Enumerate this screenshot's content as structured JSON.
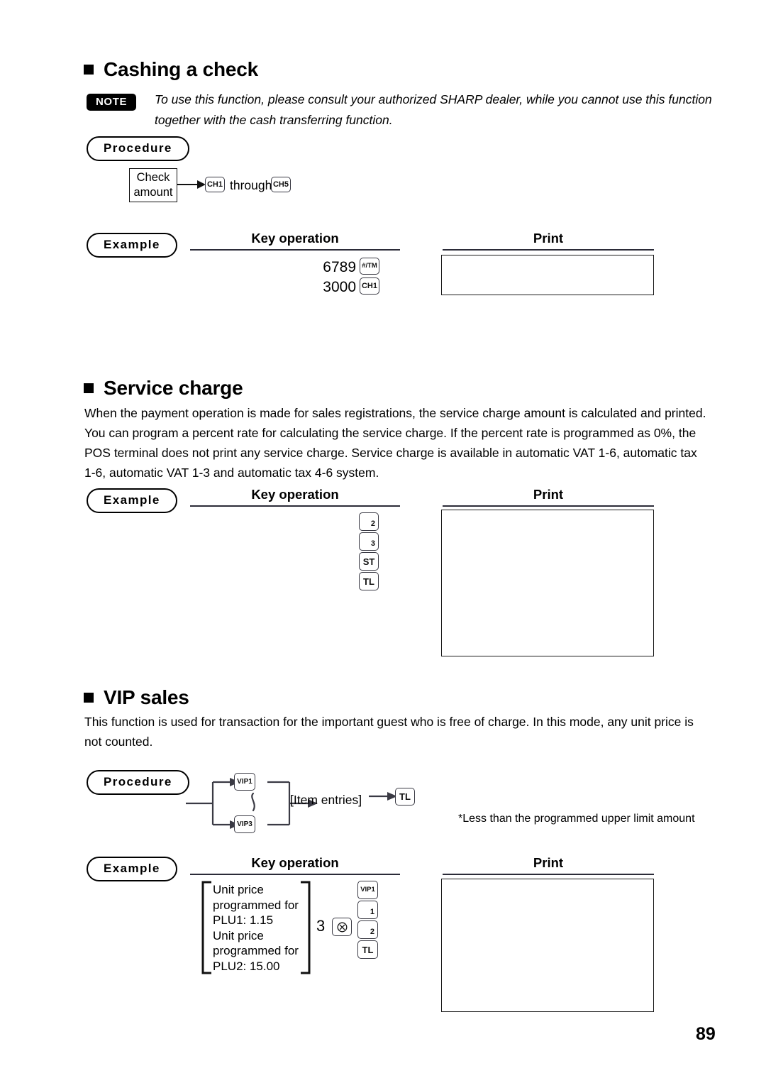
{
  "page": {
    "number": "89"
  },
  "sections": [
    {
      "id": "cashing-a-check",
      "title": "Cashing a check",
      "note": {
        "badge": "NOTE",
        "text": "To use this function, please consult your authorized SHARP dealer, while you cannot use this function together with the cash transferring function."
      },
      "procedure": {
        "badge": "Procedure",
        "start_box": "Check amount",
        "start_box_line1": "Check",
        "start_box_line2": "amount",
        "key_from": "CH1",
        "connector_text": "through",
        "key_to": "CH5"
      },
      "example": {
        "badge": "Example",
        "key_operation_caption": "Key operation",
        "print_caption": "Print",
        "rows": [
          {
            "amount": "6789",
            "key": "#/TM"
          },
          {
            "amount": "3000",
            "key": "CH1"
          }
        ],
        "print_content": ""
      }
    },
    {
      "id": "service-charge",
      "title": "Service charge",
      "body": "When the payment operation is made for sales registrations, the service charge amount is calculated and printed. You can program a percent rate for calculating the service charge. If the percent rate is programmed as 0%, the POS terminal does not print any service charge. Service charge is available in automatic VAT 1-6, automatic tax 1-6, automatic VAT 1-3 and automatic tax 4-6 system.",
      "example": {
        "badge": "Example",
        "key_operation_caption": "Key operation",
        "print_caption": "Print",
        "keys": [
          {
            "label": "2",
            "type": "num"
          },
          {
            "label": "3",
            "type": "num"
          },
          {
            "label": "ST",
            "type": "fn"
          },
          {
            "label": "TL",
            "type": "fn"
          }
        ],
        "print_content": ""
      }
    },
    {
      "id": "vip-sales",
      "title": "VIP sales",
      "body": "This function is used for transaction for the important guest who is free of charge. In this mode, any unit price is not counted.",
      "procedure": {
        "badge": "Procedure",
        "key_top": "VIP1",
        "key_bottom": "VIP3",
        "item_entries": "[Item entries]",
        "key_end": "TL",
        "footnote": "*Less than the programmed upper limit amount"
      },
      "example": {
        "badge": "Example",
        "key_operation_caption": "Key operation",
        "print_caption": "Print",
        "bracket_lines": [
          "Unit price",
          "programmed for",
          "PLU1: 1.15",
          "Unit price",
          "programmed for",
          "PLU2: 15.00"
        ],
        "multiplier": "3",
        "multiply_key": "multiply-icon",
        "keys": [
          {
            "label": "VIP1",
            "type": "fn"
          },
          {
            "label": "1",
            "type": "num"
          },
          {
            "label": "2",
            "type": "num"
          },
          {
            "label": "TL",
            "type": "fn"
          }
        ],
        "print_content": ""
      }
    }
  ],
  "colors": {
    "ink": "#000000",
    "rule": "#2b2b38",
    "key_border": "#3a3a44",
    "badge_bg": "#000000",
    "badge_fg": "#ffffff"
  }
}
